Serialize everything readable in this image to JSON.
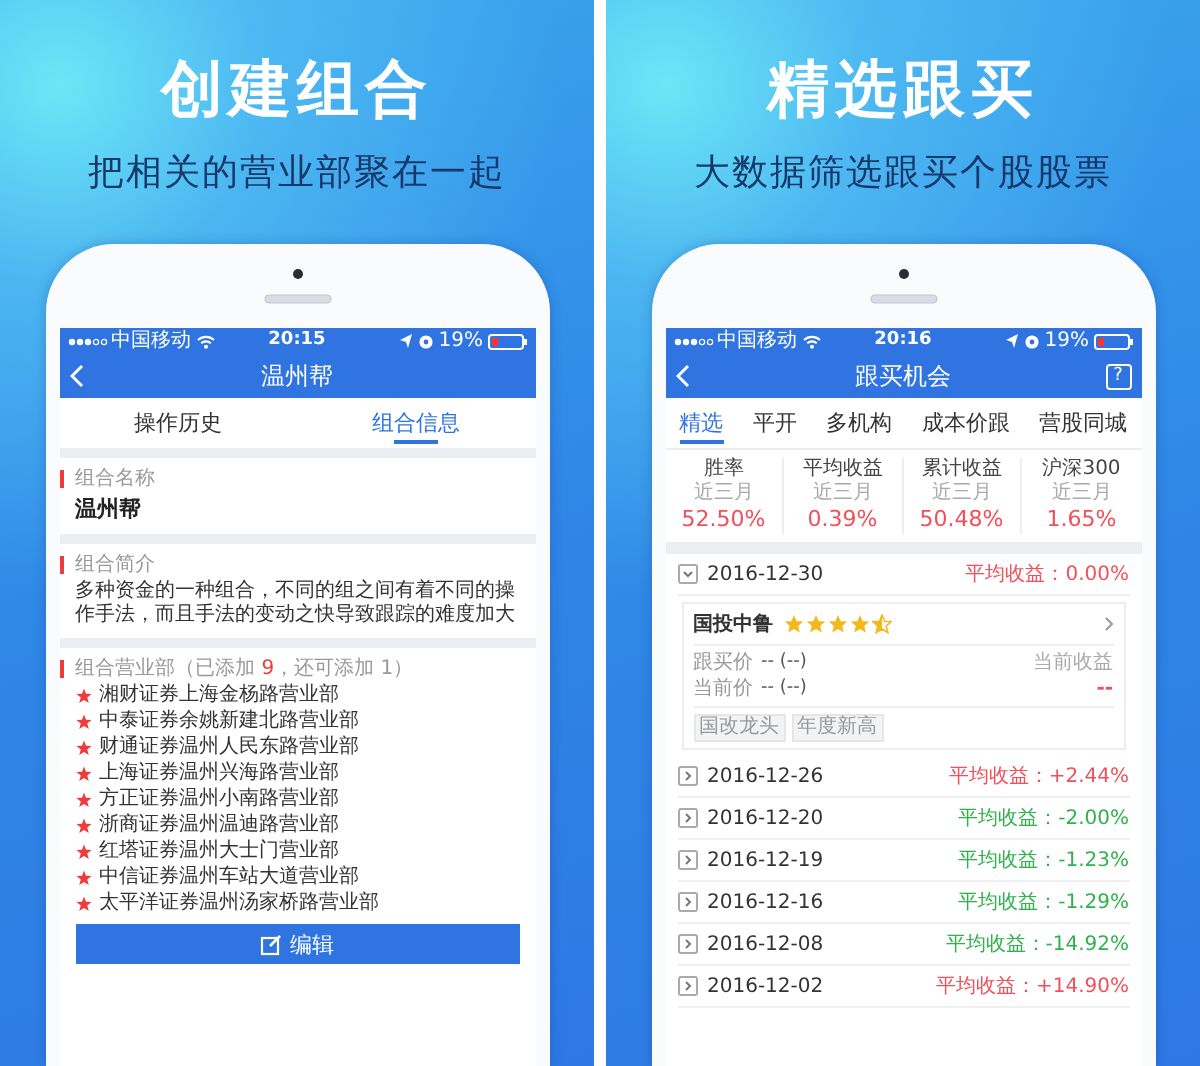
{
  "panels": [
    {
      "kind": "group_info",
      "headline": "创建组合",
      "subtitle": "把相关的营业部聚在一起",
      "status_bar": {
        "carrier": "中国移动",
        "time": "20:15",
        "battery": "19%"
      },
      "nav": {
        "title": "温州帮"
      },
      "tabs": [
        {
          "label": "操作历史",
          "selected": false
        },
        {
          "label": "组合信息",
          "selected": true
        }
      ],
      "name_card": {
        "label": "组合名称",
        "value": "温州帮"
      },
      "intro_card": {
        "label": "组合简介",
        "text": "多种资金的一种组合，不同的组之间有着不同的操作手法，而且手法的变动之快导致跟踪的难度加大"
      },
      "branches": {
        "header_start": "组合营业部（已添加 ",
        "added": "9",
        "header_end": "，还可添加 1）",
        "items": [
          "湘财证券上海金杨路营业部",
          "中泰证券余姚新建北路营业部",
          "财通证券温州人民东路营业部",
          "上海证券温州兴海路营业部",
          "方正证券温州小南路营业部",
          "浙商证券温州温迪路营业部",
          "红塔证券温州大士门营业部",
          "中信证券温州车站大道营业部",
          "太平洋证券温州汤家桥路营业部"
        ]
      },
      "button": "编辑"
    },
    {
      "kind": "follow_buy",
      "headline": "精选跟买",
      "subtitle": "大数据筛选跟买个股股票",
      "status_bar": {
        "carrier": "中国移动",
        "time": "20:16",
        "battery": "19%"
      },
      "nav": {
        "title": "跟买机会",
        "help": "?"
      },
      "tabs": [
        {
          "label": "精选",
          "selected": true
        },
        {
          "label": "平开",
          "selected": false
        },
        {
          "label": "多机构",
          "selected": false
        },
        {
          "label": "成本价跟",
          "selected": false
        },
        {
          "label": "营股同城",
          "selected": false
        }
      ],
      "stats": [
        {
          "label": "胜率",
          "period": "近三月",
          "value": "52.50%"
        },
        {
          "label": "平均收益",
          "period": "近三月",
          "value": "0.39%"
        },
        {
          "label": "累计收益",
          "period": "近三月",
          "value": "50.48%"
        },
        {
          "label": "沪深300",
          "period": "近三月",
          "value": "1.65%"
        }
      ],
      "groups": [
        {
          "date": "2016-12-30",
          "summary": "平均收益：0.00%",
          "color": "#f0505a",
          "expanded": true,
          "stock": {
            "name": "国投中鲁",
            "stars": 4.5,
            "buy_label": "跟买价",
            "buy_value": "-- (--)",
            "current_label": "当前价",
            "current_value": "-- (--)",
            "return_label": "当前收益",
            "return_value": "--",
            "tags": [
              "国改龙头",
              "年度新高"
            ]
          }
        },
        {
          "date": "2016-12-26",
          "summary": "平均收益：+2.44%",
          "color": "#f0505a",
          "expanded": false
        },
        {
          "date": "2016-12-20",
          "summary": "平均收益：-2.00%",
          "color": "#2fb24a",
          "expanded": false
        },
        {
          "date": "2016-12-19",
          "summary": "平均收益：-1.23%",
          "color": "#2fb24a",
          "expanded": false
        },
        {
          "date": "2016-12-16",
          "summary": "平均收益：-1.29%",
          "color": "#2fb24a",
          "expanded": false
        },
        {
          "date": "2016-12-08",
          "summary": "平均收益：-14.92%",
          "color": "#2fb24a",
          "expanded": false
        },
        {
          "date": "2016-12-02",
          "summary": "平均收益：+14.90%",
          "color": "#f0505a",
          "expanded": false
        }
      ]
    }
  ]
}
